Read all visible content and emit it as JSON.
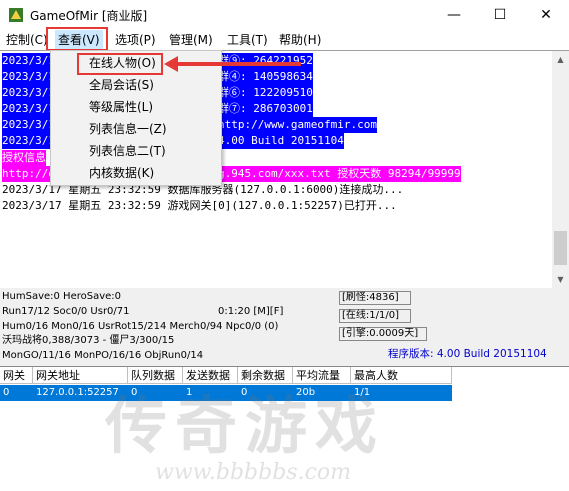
{
  "window": {
    "title": "GameOfMir [商业版]",
    "minimize": "—",
    "maximize": "☐",
    "close": "✕"
  },
  "menu": [
    {
      "label": "控制(C)"
    },
    {
      "label": "查看(V)"
    },
    {
      "label": "选项(P)"
    },
    {
      "label": "管理(M)"
    },
    {
      "label": "工具(T)"
    },
    {
      "label": "帮助(H)"
    }
  ],
  "dropdown": [
    {
      "label": "在线人物(O)"
    },
    {
      "label": "全局会话(S)"
    },
    {
      "label": "等级属性(L)"
    },
    {
      "label": "列表信息一(Z)"
    },
    {
      "label": "列表信息二(T)"
    },
    {
      "label": "内核数据(K)"
    }
  ],
  "log": {
    "lines": [
      {
        "left": "2023/3/17",
        "right": "群⑨: 264221952"
      },
      {
        "left": "2023/3/17",
        "right": "群④: 140598634"
      },
      {
        "left": "2023/3/17",
        "right": "群⑥: 122209510"
      },
      {
        "left": "2023/3/17",
        "right": "群⑦: 286703001"
      },
      {
        "left": "2023/3/17",
        "right": "http://www.gameofmir.com"
      },
      {
        "left": "2023/3/17",
        "right": "4.00 Build 20151104"
      },
      {
        "left": "授权信息",
        "right": ""
      },
      {
        "left": "http://d",
        "right": "g.945.com/xxx.txt 授权天数 98294/99999"
      },
      {
        "left": "2023/3/17 星期五 23:32:59",
        "right": "数据库服务器(127.0.0.1:6000)连接成功..."
      },
      {
        "left": "2023/3/17 星期五 23:32:59",
        "right": "游戏网关[0](127.0.0.1:52257)已打开..."
      }
    ]
  },
  "status": {
    "line1": "HumSave:0 HeroSave:0",
    "line2": "Run17/12 Soc0/0 Usr0/71",
    "time": "0:1:20 [M][F]",
    "line3": "Hum0/16 Mon0/16 UsrRot15/214 Merch0/94 Npc0/0 (0)",
    "line4": "沃玛战将0,388/3073 - 僵尸3/300/15",
    "line5": "MonGO/11/16 MonPO/16/16 ObjRun0/14",
    "box1": "[刷怪:4836]",
    "box2": "[在线:1/1/0]",
    "box3": "[引擎:0.0009天]",
    "version": "程序版本: 4.00 Build 20151104"
  },
  "table": {
    "headers": [
      "网关",
      "网关地址",
      "队列数据",
      "发送数据",
      "剩余数据",
      "平均流量",
      "最高人数"
    ],
    "rows": [
      [
        "0",
        "127.0.0.1:52257",
        "0",
        "1",
        "0",
        "20b",
        "1/1"
      ]
    ]
  },
  "watermark": {
    "text": "传奇游戏",
    "url": "www.bbbbbs.com"
  },
  "colors": {
    "selection": "#0000ff",
    "license": "#ff00ff",
    "annotation": "#e53935",
    "row": "#0078d7"
  }
}
